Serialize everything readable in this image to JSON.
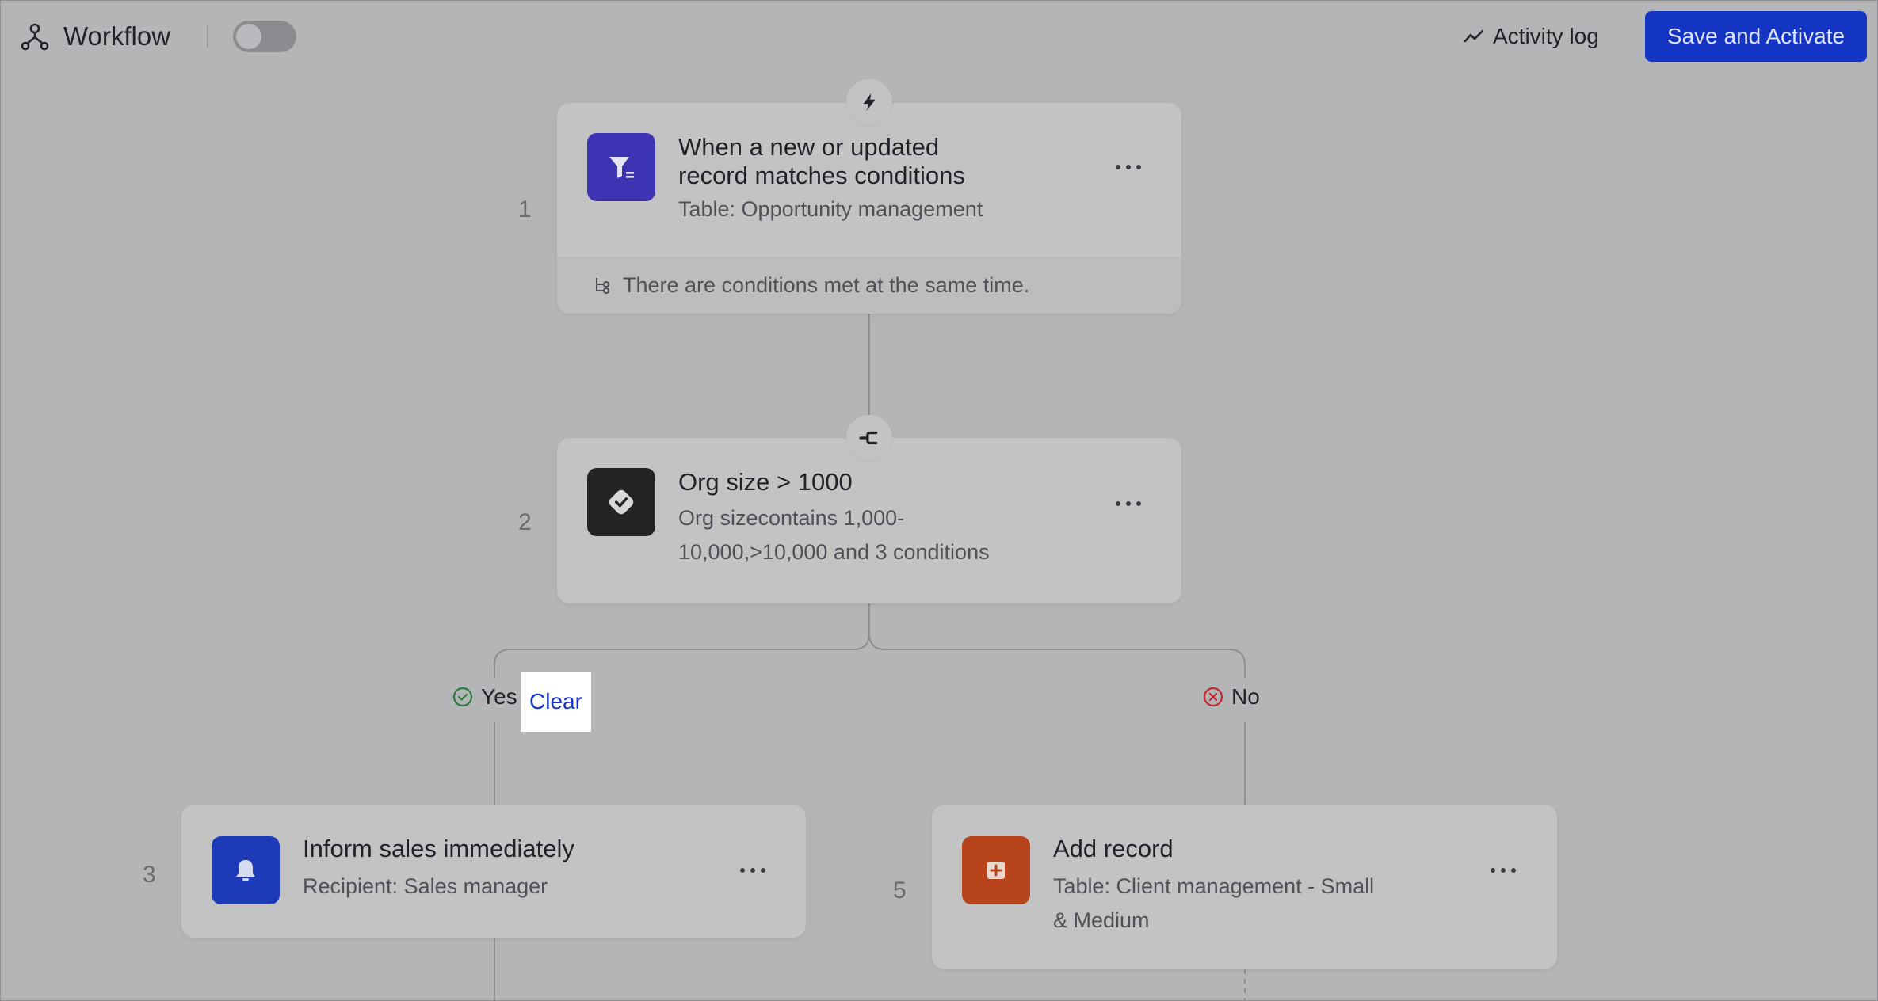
{
  "header": {
    "title": "Workflow",
    "activity_log": "Activity log",
    "save_label": "Save and Activate"
  },
  "steps": [
    {
      "number": "1",
      "title_line1": "When a new or updated",
      "title_line2": "record matches conditions",
      "subtitle": "Table: Opportunity management",
      "footer": "There are conditions met at the same time.",
      "icon": "filter-icon",
      "icon_color": "#3d34b3",
      "badge_icon": "lightning-icon"
    },
    {
      "number": "2",
      "title": "Org size > 1000",
      "subtitle_line1": "Org sizecontains 1,000-",
      "subtitle_line2": "10,000,>10,000 and 3 conditions",
      "icon": "condition-check-icon",
      "icon_color": "#222325",
      "badge_icon": "branch-icon"
    },
    {
      "number": "3",
      "title": "Inform sales immediately",
      "subtitle": "Recipient: Sales manager",
      "icon": "bell-icon",
      "icon_color": "#1d3bb8"
    },
    {
      "number": "5",
      "title": "Add record",
      "subtitle_line1": "Table: Client management - Small",
      "subtitle_line2": "& Medium",
      "icon": "add-record-icon",
      "icon_color": "#b7441b"
    }
  ],
  "branches": {
    "yes_label": "Yes",
    "clear_label": "Clear",
    "no_label": "No",
    "yes_color": "#2d7a3a",
    "no_color": "#c4282e"
  }
}
